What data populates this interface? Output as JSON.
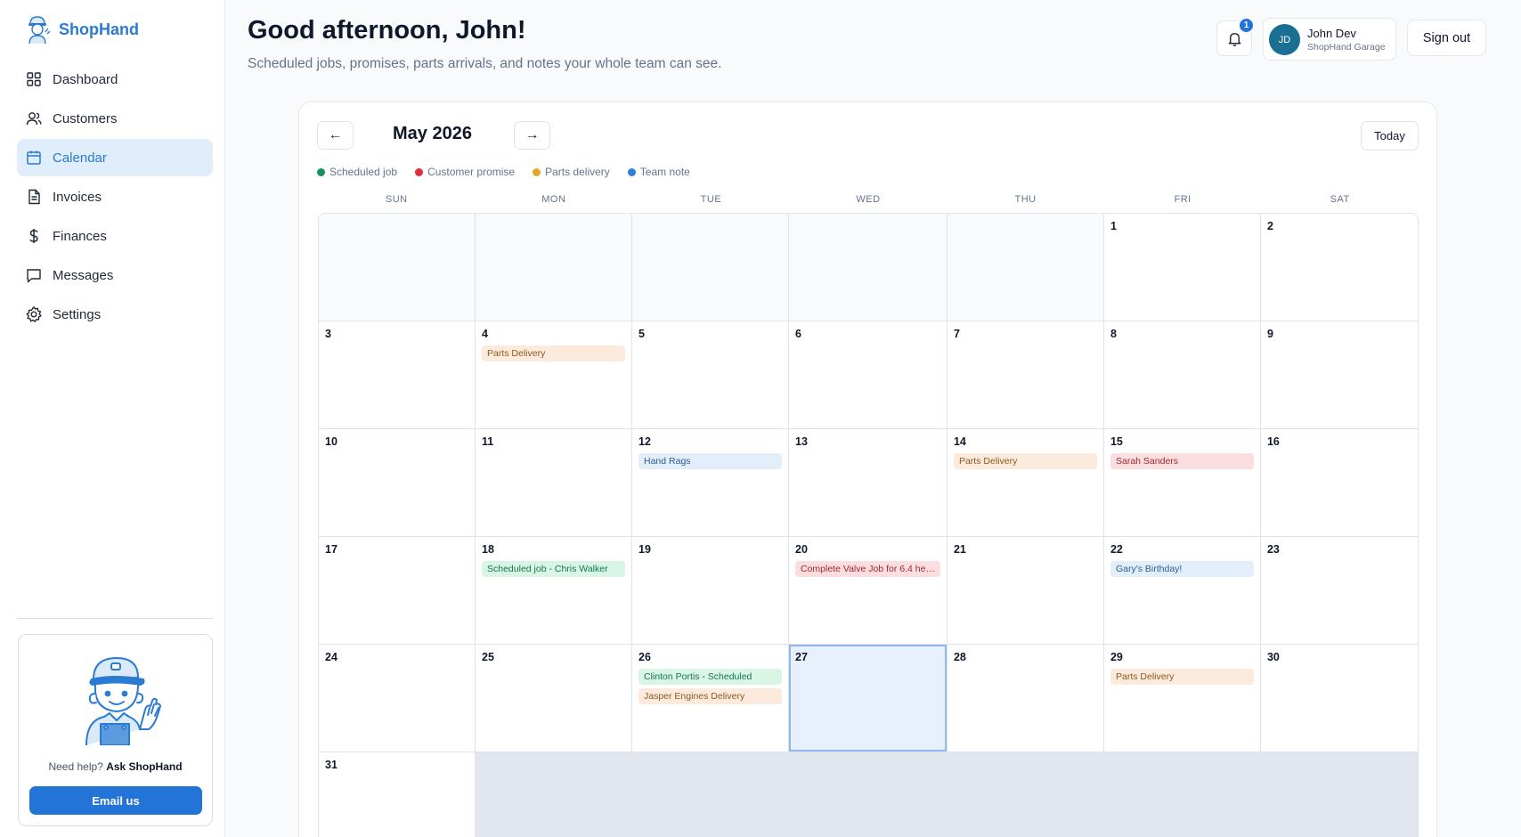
{
  "app": {
    "brand": "ShopHand",
    "nav": [
      {
        "label": "Dashboard",
        "icon": "dashboard-icon",
        "active": false
      },
      {
        "label": "Customers",
        "icon": "users-icon",
        "active": false
      },
      {
        "label": "Calendar",
        "icon": "calendar-icon",
        "active": true
      },
      {
        "label": "Invoices",
        "icon": "document-icon",
        "active": false
      },
      {
        "label": "Finances",
        "icon": "dollar-icon",
        "active": false
      },
      {
        "label": "Messages",
        "icon": "message-icon",
        "active": false
      },
      {
        "label": "Settings",
        "icon": "gear-icon",
        "active": false
      }
    ],
    "help": {
      "prefix": "Need help?",
      "strong": "Ask ShopHand",
      "button": "Email us"
    }
  },
  "header": {
    "greeting": "Good afternoon, John!",
    "subtitle": "Scheduled jobs, promises, parts arrivals, and notes your whole team can see.",
    "notification_count": "1",
    "user": {
      "initials": "JD",
      "name": "John Dev",
      "org": "ShopHand Garage"
    },
    "signout": "Sign out"
  },
  "calendar": {
    "prev": "←",
    "next": "→",
    "month": "May 2026",
    "today": "Today",
    "legend": [
      {
        "label": "Scheduled job",
        "color": "#14935a"
      },
      {
        "label": "Customer promise",
        "color": "#d9303a"
      },
      {
        "label": "Parts delivery",
        "color": "#e0a92a"
      },
      {
        "label": "Team note",
        "color": "#2f7fdc"
      }
    ],
    "weekdays": [
      "SUN",
      "MON",
      "TUE",
      "WED",
      "THU",
      "FRI",
      "SAT"
    ],
    "leading_empty": 5,
    "days_in_month": 31,
    "today_day": 27,
    "events": {
      "4": [
        {
          "title": "Parts Delivery",
          "kind": "parts"
        }
      ],
      "12": [
        {
          "title": "Hand Rags",
          "kind": "note"
        }
      ],
      "14": [
        {
          "title": "Parts Delivery",
          "kind": "parts"
        }
      ],
      "15": [
        {
          "title": "Sarah Sanders",
          "kind": "promise"
        }
      ],
      "18": [
        {
          "title": "Scheduled job - Chris Walker",
          "kind": "job"
        }
      ],
      "20": [
        {
          "title": "Complete Valve Job for 6.4 he…",
          "kind": "promise"
        }
      ],
      "22": [
        {
          "title": "Gary's Birthday!",
          "kind": "note"
        }
      ],
      "26": [
        {
          "title": "Clinton Portis - Scheduled",
          "kind": "job"
        },
        {
          "title": "Jasper Engines Delivery",
          "kind": "parts"
        }
      ],
      "29": [
        {
          "title": "Parts Delivery",
          "kind": "parts"
        }
      ]
    }
  }
}
